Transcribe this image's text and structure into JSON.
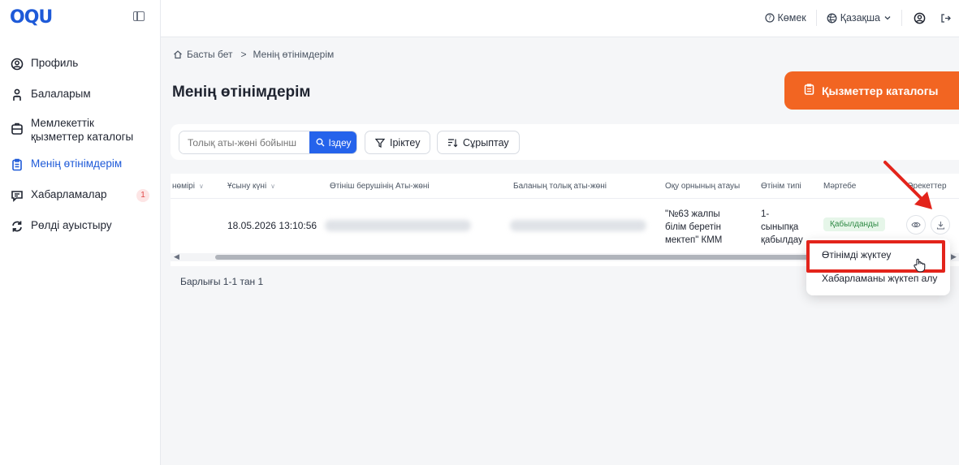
{
  "app": {
    "logo_text": "OQU"
  },
  "topbar": {
    "help_label": "Көмек",
    "language_label": "Қазақша"
  },
  "sidebar": {
    "items": [
      {
        "label": "Профиль",
        "icon": "user-circle-icon"
      },
      {
        "label": "Балаларым",
        "icon": "child-icon"
      },
      {
        "label": "Мемлекеттік қызметтер каталогы",
        "icon": "catalog-icon"
      },
      {
        "label": "Менің өтінімдерім",
        "icon": "clipboard-icon",
        "active": true
      },
      {
        "label": "Хабарламалар",
        "icon": "message-icon",
        "badge": "1"
      },
      {
        "label": "Рөлді ауыстыру",
        "icon": "switch-icon"
      }
    ]
  },
  "breadcrumb": {
    "home": "Басты бет",
    "separator": ">",
    "current": "Менің өтінімдерім"
  },
  "page": {
    "title": "Менің өтінімдерім",
    "catalog_button": "Қызметтер каталогы"
  },
  "filters": {
    "search_placeholder": "Толық аты-жөні бойынш",
    "search_button": "Іздеу",
    "filter_button": "Іріктеу",
    "sort_button": "Сұрыптау"
  },
  "table": {
    "columns": [
      "нөмірі",
      "Ұсыну күні",
      "Өтініш берушінің Аты-жөні",
      "Баланың толық аты-жөні",
      "Оқу орнының атауы",
      "Өтінім типі",
      "Мәртебе",
      "Әрекеттер"
    ],
    "rows": [
      {
        "date": "18.05.2026 13:10:56",
        "school_lines": [
          "\"№63 жалпы",
          "білім беретін",
          "мектеп\" КММ"
        ],
        "type_lines": [
          "1-",
          "сыныпқа",
          "қабылдау"
        ],
        "status": "Қабылданды"
      }
    ]
  },
  "footer": {
    "total": "Барлығы 1-1 тан 1"
  },
  "dropdown": {
    "items": [
      "Өтінімді жүктеу",
      "Хабарламаны жүктеп алу"
    ]
  },
  "colors": {
    "accent": "#1e5ad8",
    "orange": "#f26522",
    "highlight": "#e3241b"
  }
}
